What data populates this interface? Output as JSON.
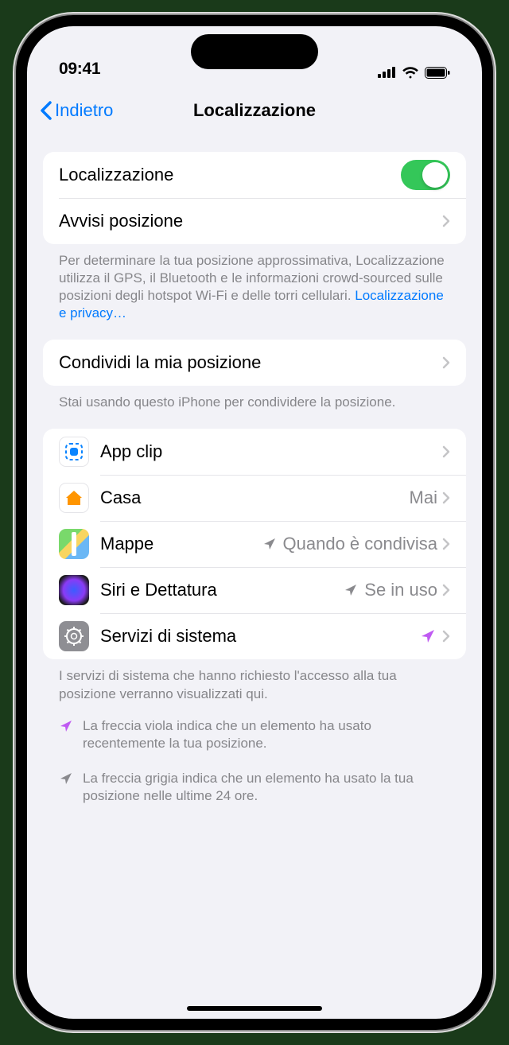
{
  "status": {
    "time": "09:41"
  },
  "nav": {
    "back": "Indietro",
    "title": "Localizzazione"
  },
  "group1": {
    "toggle_label": "Localizzazione",
    "alerts_label": "Avvisi posizione"
  },
  "footer1": {
    "text": "Per determinare la tua posizione approssimativa, Localizzazione utilizza il GPS, il Bluetooth e le informazioni crowd-sourced sulle posizioni degli hotspot Wi-Fi e delle torri cellulari. ",
    "link": "Localizzazione e privacy…"
  },
  "group2": {
    "share_label": "Condividi la mia posizione"
  },
  "footer2": "Stai usando questo iPhone per condividere la posizione.",
  "apps": {
    "appclip": {
      "label": "App clip"
    },
    "casa": {
      "label": "Casa",
      "detail": "Mai"
    },
    "mappe": {
      "label": "Mappe",
      "detail": "Quando è condivisa"
    },
    "siri": {
      "label": "Siri e Dettatura",
      "detail": "Se in uso"
    },
    "system": {
      "label": "Servizi di sistema"
    }
  },
  "footer3": "I servizi di sistema che hanno richiesto l'accesso alla tua posizione verranno visualizzati qui.",
  "legend": {
    "purple": "La freccia viola indica che un elemento ha usato recentemente la tua posizione.",
    "gray": "La freccia grigia indica che un elemento ha usato la tua posizione nelle ultime 24 ore."
  }
}
